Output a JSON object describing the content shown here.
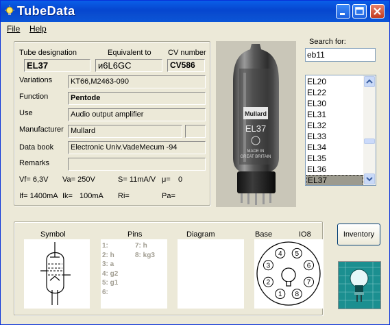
{
  "window": {
    "title": "TubeData"
  },
  "menu": {
    "file": "File",
    "help": "Help"
  },
  "labels": {
    "tube_designation": "Tube designation",
    "equivalent_to": "Equivalent to",
    "cv_number": "CV number",
    "variations": "Variations",
    "function": "Function",
    "use": "Use",
    "manufacturer": "Manufacturer",
    "data_book": "Data book",
    "remarks": "Remarks"
  },
  "fields": {
    "tube_designation": "EL37",
    "equivalent_to": "и6L6GC",
    "cv_number": "CV586",
    "variations": "KT66,M2463-090",
    "function": "Pentode",
    "use": "Audio output amplifier",
    "manufacturer": "Mullard",
    "manufacturer_code": "",
    "data_book": "Electronic Univ.VadeMecum -94",
    "remarks": ""
  },
  "specs": {
    "vf": "Vf= 6,3V",
    "va": "Va= 250V",
    "s": "S= 11mA/V",
    "mu": "μ=",
    "mu_val": "0",
    "if": "If= 1400mA",
    "ik": "Ik= ",
    "ik_val": "100mA",
    "ri": "Ri=",
    "pa": "Pa="
  },
  "photo": {
    "brand": "Mullard",
    "type": "EL37",
    "made_in": "MADE IN",
    "country": "GREAT BRITAIN"
  },
  "search": {
    "label": "Search for:",
    "value": "eb11"
  },
  "tube_list": [
    "EL20",
    "EL22",
    "EL30",
    "EL31",
    "EL32",
    "EL33",
    "EL34",
    "EL35",
    "EL36",
    "EL37"
  ],
  "tube_list_selected": "EL37",
  "bottom": {
    "symbol": "Symbol",
    "pins": "Pins",
    "diagram": "Diagram",
    "base": "Base",
    "base_type": "IO8",
    "pins_left": [
      "1:",
      "2: h",
      "3: a",
      "4: g2",
      "5: g1",
      "6:"
    ],
    "pins_right": [
      "7: h",
      "8: kg3"
    ],
    "socket_pins": [
      "1",
      "2",
      "3",
      "4",
      "5",
      "6",
      "7",
      "8"
    ]
  },
  "buttons": {
    "inventory": "Inventory"
  },
  "colors": {
    "titlebar": "#0a54dc",
    "window_bg": "#ece9d8",
    "list_selection": "#9c9a8e",
    "logo_bg": "#1b8f90"
  },
  "icons": [
    "lightbulb-icon",
    "minimize-icon",
    "maximize-icon",
    "close-icon",
    "scroll-up-icon",
    "scroll-down-icon"
  ]
}
